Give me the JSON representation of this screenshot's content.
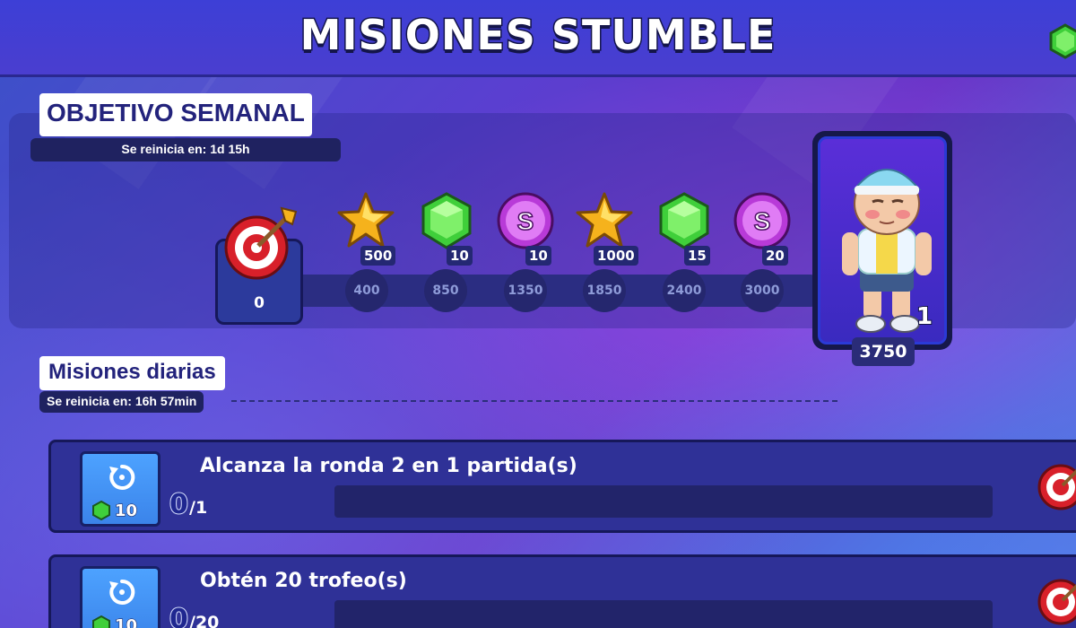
{
  "header": {
    "title": "MISIONES STUMBLE"
  },
  "weekly": {
    "title": "OBJETIVO SEMANAL",
    "reset": "Se reinicia en: 1d 15h",
    "current_points": "0",
    "rewards": [
      {
        "icon": "star-icon",
        "amount": "500",
        "milestone": "400"
      },
      {
        "icon": "gem-icon",
        "amount": "10",
        "milestone": "850"
      },
      {
        "icon": "stumble-token-icon",
        "amount": "10",
        "milestone": "1350"
      },
      {
        "icon": "star-icon",
        "amount": "1000",
        "milestone": "1850"
      },
      {
        "icon": "gem-icon",
        "amount": "15",
        "milestone": "2400"
      },
      {
        "icon": "stumble-token-icon",
        "amount": "20",
        "milestone": "3000"
      }
    ],
    "final_reward": {
      "icon": "character-skin",
      "count": "1",
      "milestone": "3750"
    }
  },
  "daily": {
    "title": "Misiones diarias",
    "reset": "Se reinicia en: 16h 57min",
    "missions": [
      {
        "text": "Alcanza la ronda 2 en 1 partida(s)",
        "progress": "0",
        "total": "/1",
        "refresh_cost": "10"
      },
      {
        "text": "Obtén 20 trofeo(s)",
        "progress": "0",
        "total": "/20",
        "refresh_cost": "10"
      }
    ]
  },
  "colors": {
    "accent": "#3b84ea",
    "panel": "#2f3197",
    "gem": "#3fcf3a",
    "star": "#f5b21c",
    "token": "#b83ad8"
  }
}
